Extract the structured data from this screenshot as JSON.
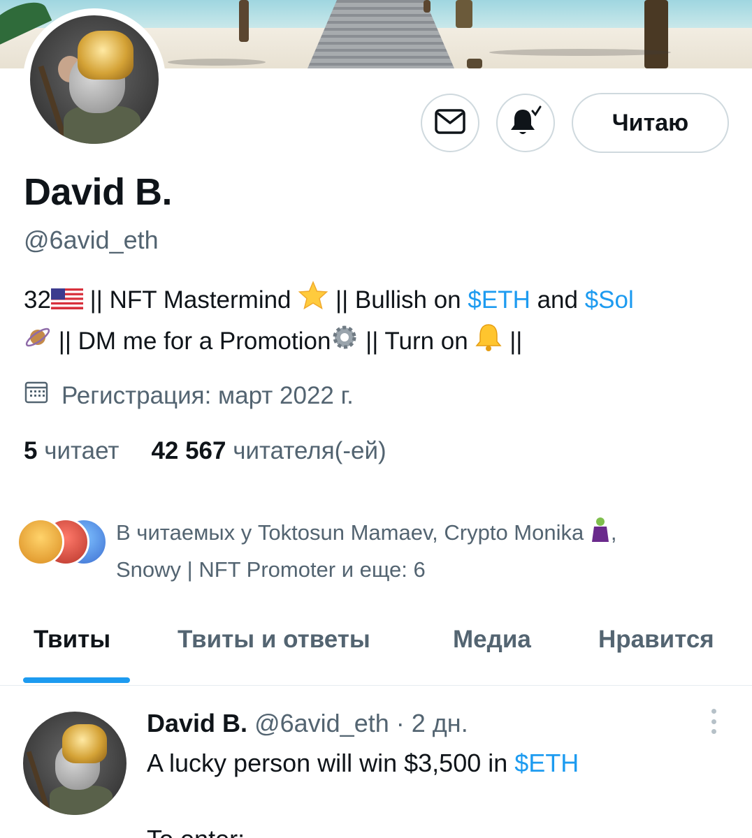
{
  "profile": {
    "name": "David B.",
    "handle": "@6avid_eth",
    "follow_label": "Читаю",
    "bio": {
      "age": "32",
      "part1": " || NFT Mastermind ",
      "part2": " || Bullish on ",
      "eth_link": "$ETH",
      "and": " and ",
      "sol_link": "$Sol",
      "part3": " || DM me for a Promotion",
      "part4": " || Turn on ",
      "part5": " ||"
    },
    "joined": "Регистрация: март 2022 г.",
    "following_count": "5",
    "following_label": "читает",
    "followers_count": "42 567",
    "followers_label": "читателя(-ей)",
    "followed_by_line1": "В читаемых у Toktosun Mamaev, Crypto Monika",
    "followed_by_line1_end": ",",
    "followed_by_line2": "Snowy | NFT Promoter и еще: 6"
  },
  "tabs": [
    {
      "label": "Твиты",
      "active": true
    },
    {
      "label": "Твиты и ответы",
      "active": false
    },
    {
      "label": "Медиа",
      "active": false
    },
    {
      "label": "Нравится",
      "active": false
    }
  ],
  "tweet": {
    "author": "David B.",
    "handle": "@6avid_eth",
    "separator": "·",
    "time": "2 дн.",
    "text_prefix": "A lucky person will win $3,500 in ",
    "text_link": "$ETH",
    "text_line3": "To enter:"
  },
  "icons": {
    "message": "mail-icon",
    "notifications": "bell-check-icon",
    "calendar": "calendar-icon",
    "more": "more-vertical-icon"
  },
  "colors": {
    "accent": "#1d9bf0",
    "secondary_text": "#536471",
    "primary_text": "#0f1419",
    "border": "#cfd9de"
  }
}
